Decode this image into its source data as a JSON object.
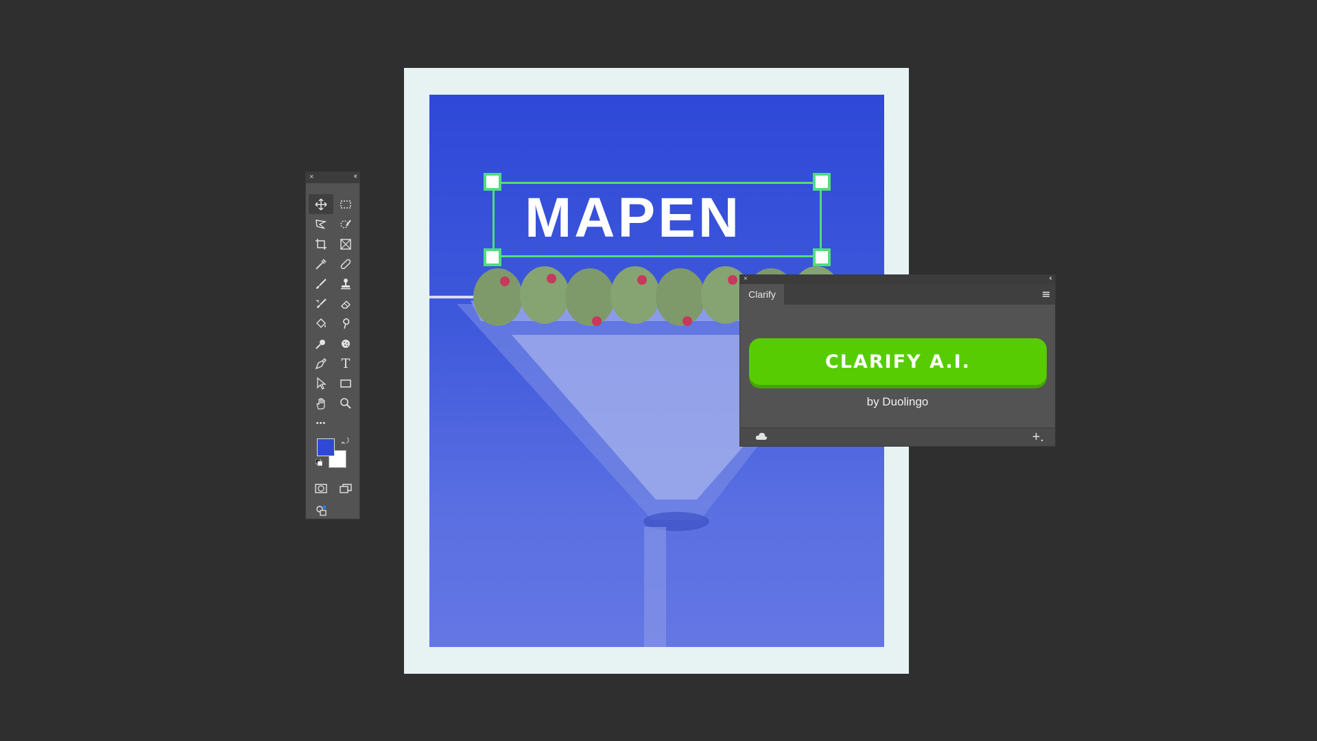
{
  "canvas": {
    "headline": "MAPEN",
    "colors": {
      "frame": "#e7f2f3",
      "artwork_blue": "#2f48d8",
      "selection": "#53dc7b"
    }
  },
  "tools_panel": {
    "close_glyph": "×",
    "collapse_glyph": "‹‹",
    "tools": [
      {
        "name": "move-tool",
        "icon": "move-icon"
      },
      {
        "name": "marquee-tool",
        "icon": "rectangle-marquee-icon"
      },
      {
        "name": "lasso-tool",
        "icon": "polygon-lasso-icon"
      },
      {
        "name": "quick-select-tool",
        "icon": "quick-selection-icon"
      },
      {
        "name": "crop-tool",
        "icon": "crop-icon"
      },
      {
        "name": "frame-tool",
        "icon": "frame-icon"
      },
      {
        "name": "eyedropper-tool",
        "icon": "eyedropper-icon"
      },
      {
        "name": "healing-tool",
        "icon": "bandage-icon"
      },
      {
        "name": "brush-tool",
        "icon": "brush-icon"
      },
      {
        "name": "stamp-tool",
        "icon": "stamp-icon"
      },
      {
        "name": "history-brush-tool",
        "icon": "history-brush-icon"
      },
      {
        "name": "eraser-tool",
        "icon": "eraser-icon"
      },
      {
        "name": "paint-bucket-tool",
        "icon": "paint-bucket-icon"
      },
      {
        "name": "smudge-tool",
        "icon": "smudge-icon"
      },
      {
        "name": "dodge-tool",
        "icon": "dodge-icon"
      },
      {
        "name": "sponge-tool",
        "icon": "sponge-icon"
      },
      {
        "name": "pen-tool",
        "icon": "pen-icon"
      },
      {
        "name": "type-tool",
        "icon": "type-icon",
        "label": "T"
      },
      {
        "name": "path-select-tool",
        "icon": "arrow-icon"
      },
      {
        "name": "shape-tool",
        "icon": "rectangle-icon"
      },
      {
        "name": "hand-tool",
        "icon": "hand-icon"
      },
      {
        "name": "zoom-tool",
        "icon": "magnifier-icon"
      },
      {
        "name": "more-tools",
        "icon": "more-icon",
        "label": "•••"
      }
    ],
    "foreground_color": "#2f48d8",
    "background_color": "#ffffff"
  },
  "clarify_panel": {
    "close_glyph": "×",
    "collapse_glyph": "‹‹",
    "tab_label": "Clarify",
    "button_label": "CLARIFY A.I.",
    "byline": "by Duolingo",
    "add_glyph": "+.",
    "colors": {
      "button": "#58cc02",
      "button_shadow": "#46a302"
    }
  }
}
